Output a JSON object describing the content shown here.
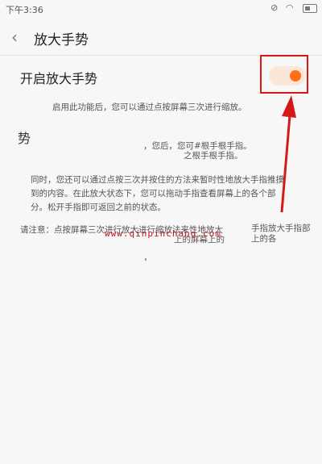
{
  "status_bar": {
    "time": "下午3:36",
    "icons": [
      "mute-icon",
      "wifi-icon",
      "battery-icon"
    ]
  },
  "header": {
    "title": "放大手势"
  },
  "setting": {
    "label": "开启放大手势",
    "toggle_state": "on"
  },
  "texts": {
    "desc1": "启用此功能后，您可以通过点按屏幕三次进行缩放。",
    "heading2": "势",
    "desc2a": "，您后，您可#根手根手指。",
    "desc2b": "之根手根手指。",
    "desc3": "同时，您还可以通过点按三次并按住的方法来暂时性地放大手指推摸到的内容。在此放大状态下，您可以拖动手指查看屏幕上的各个部分。松开手指即可返回之前的状态。",
    "desc4a": "请注意：点按屏幕三次进行放大进行缩放法来性地放大",
    "desc4b": "上的屏幕上的",
    "desc4c": "手指放大手指部上的各",
    "watermark": "www.qinpinchang.com"
  },
  "colors": {
    "accent": "#ff6f16",
    "highlight": "#d51818"
  }
}
